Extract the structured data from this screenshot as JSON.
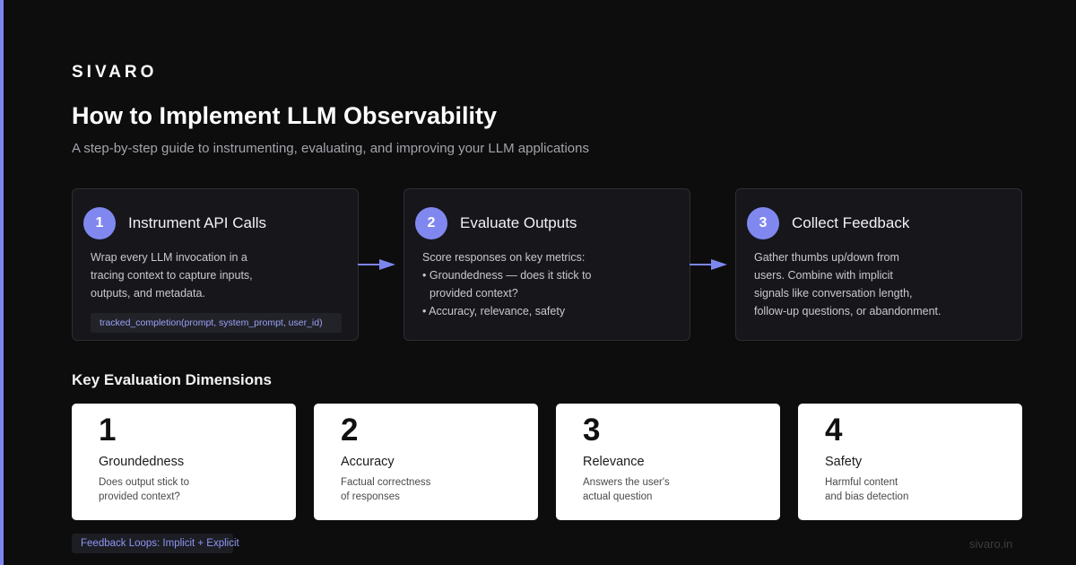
{
  "brand": "SIVARO",
  "title": "How to Implement LLM Observability",
  "subtitle": "A step-by-step guide to instrumenting, evaluating, and improving your LLM applications",
  "colors": {
    "accent": "#7c86ee",
    "badge": "#8088f0",
    "background": "#0d0d0d",
    "card": "#17171b"
  },
  "steps": [
    {
      "number": "1",
      "title": "Instrument API Calls",
      "lines": [
        "Wrap every LLM invocation in a",
        "tracing context to capture inputs,",
        "outputs, and metadata."
      ],
      "code": "tracked_completion(prompt, system_prompt, user_id)"
    },
    {
      "number": "2",
      "title": "Evaluate Outputs",
      "lines": [
        "Score responses on key metrics:",
        "• Groundedness — does it stick to",
        "provided context?",
        "• Accuracy, relevance, safety"
      ]
    },
    {
      "number": "3",
      "title": "Collect Feedback",
      "lines": [
        "Gather thumbs up/down from",
        "users. Combine with implicit",
        "signals like conversation length,",
        "follow-up questions, or abandonment."
      ]
    }
  ],
  "icons": {
    "flow_arrow": "arrow-right-icon"
  },
  "section_heading": "Key Evaluation Dimensions",
  "dimensions": [
    {
      "number": "1",
      "title": "Groundedness",
      "lines": [
        "Does output stick to",
        "provided context?"
      ]
    },
    {
      "number": "2",
      "title": "Accuracy",
      "lines": [
        "Factual correctness",
        "of responses"
      ]
    },
    {
      "number": "3",
      "title": "Relevance",
      "lines": [
        "Answers the user's",
        "actual question"
      ]
    },
    {
      "number": "4",
      "title": "Safety",
      "lines": [
        "Harmful content",
        "and bias detection"
      ]
    }
  ],
  "footer_tag": "Feedback Loops: Implicit + Explicit",
  "site": "sivaro.in"
}
